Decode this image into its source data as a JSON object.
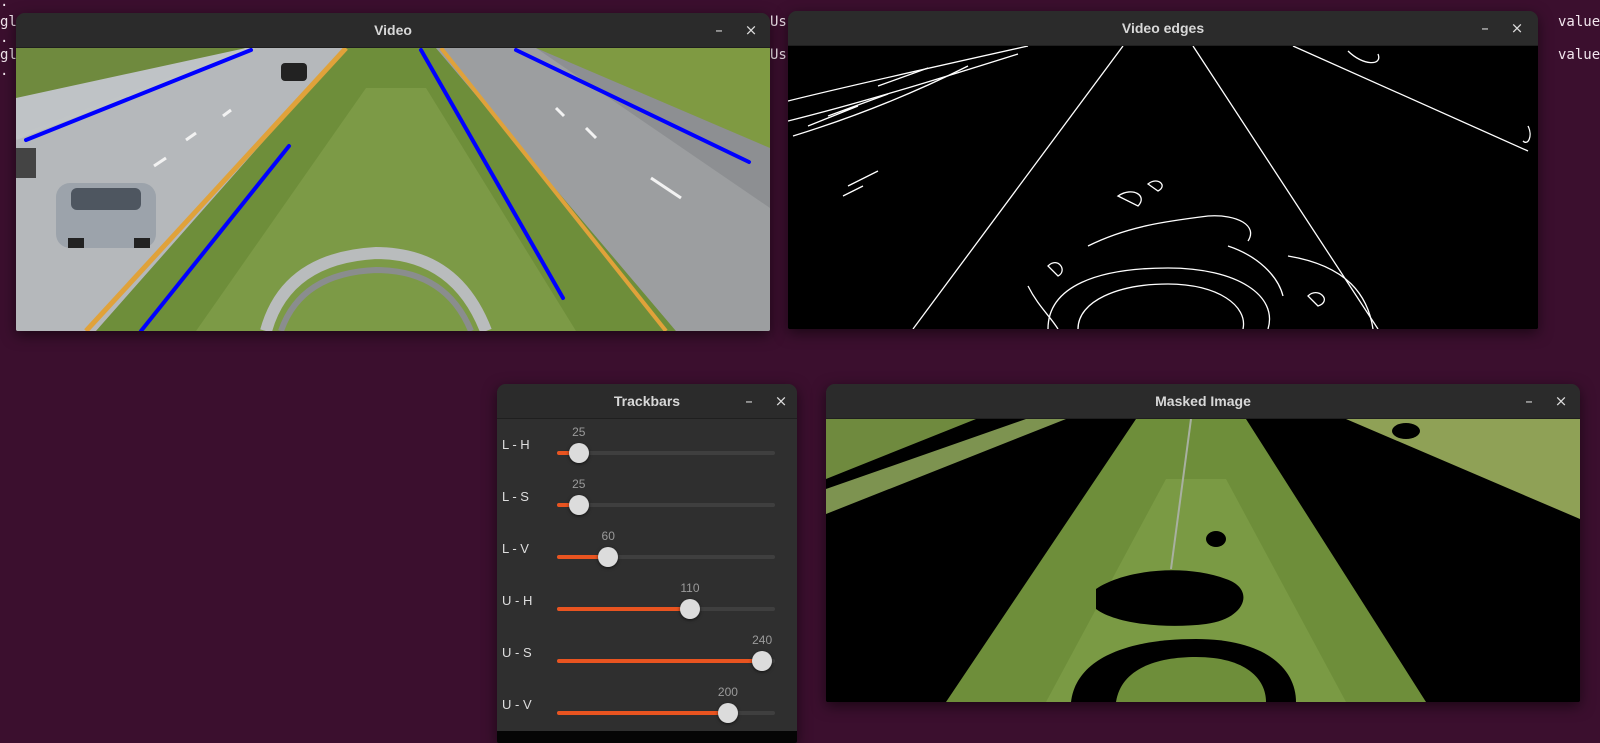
{
  "terminal": {
    "lines": [
      ".",
      "gl",
      ".",
      "gl",
      "."
    ],
    "overlap_left": [
      "Usin",
      "Usin"
    ],
    "overlap_right": [
      "value",
      "value"
    ]
  },
  "windows": {
    "video": {
      "title": "Video",
      "minimize": "–",
      "close": "×"
    },
    "edges": {
      "title": "Video edges",
      "minimize": "–",
      "close": "×"
    },
    "trackbars": {
      "title": "Trackbars",
      "minimize": "–",
      "close": "×"
    },
    "masked": {
      "title": "Masked Image",
      "minimize": "–",
      "close": "×"
    }
  },
  "trackbars": {
    "max": 255,
    "items": [
      {
        "label": "L - H",
        "value": "25",
        "level": 0.1
      },
      {
        "label": "L - S",
        "value": "25",
        "level": 0.1
      },
      {
        "label": "L - V",
        "value": "60",
        "level": 0.235
      },
      {
        "label": "U - H",
        "value": "110",
        "level": 0.61
      },
      {
        "label": "U - S",
        "value": "240",
        "level": 0.941
      },
      {
        "label": "U - V",
        "value": "200",
        "level": 0.784
      }
    ]
  },
  "colors": {
    "accent": "#e95420",
    "lane_line": "#0000ff",
    "desktop": "#3b0f2e"
  }
}
